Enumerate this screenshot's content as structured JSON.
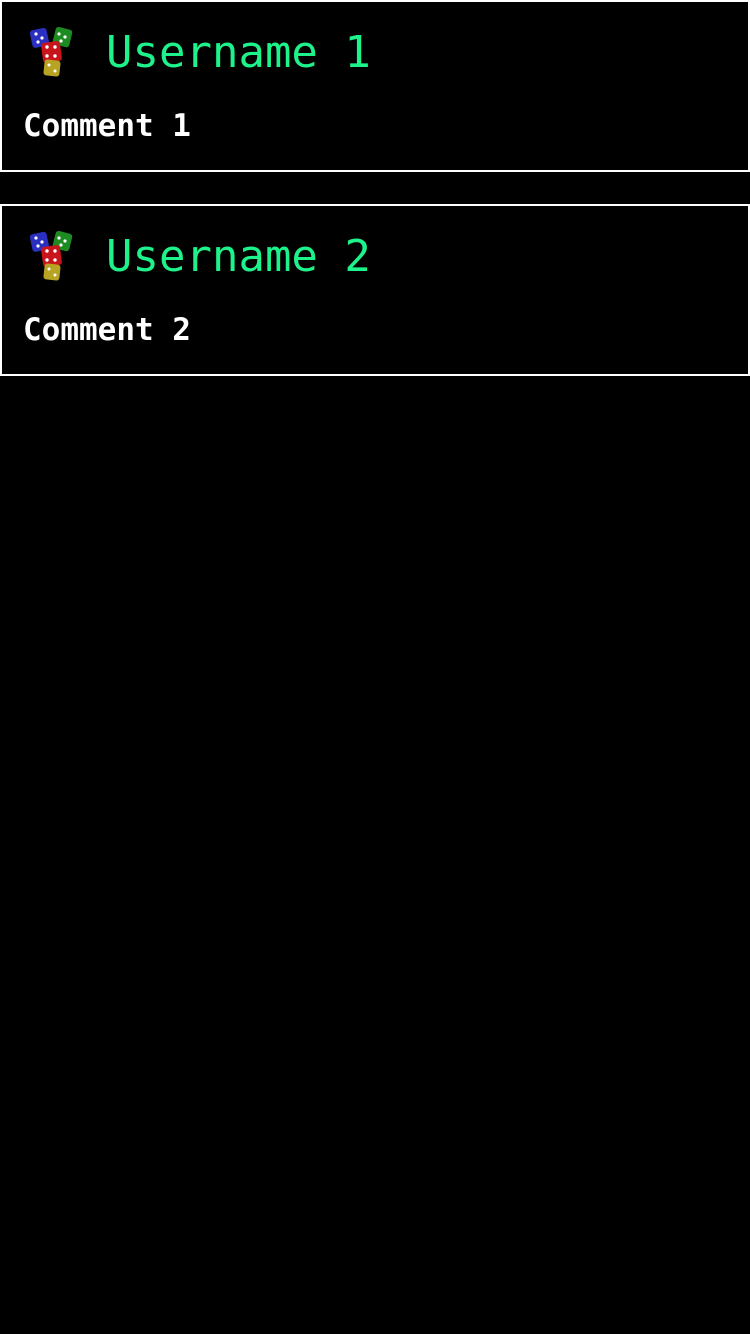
{
  "colors": {
    "background": "#000000",
    "card_border": "#ffffff",
    "username": "#1df28b",
    "comment": "#ffffff"
  },
  "comments": [
    {
      "avatar_icon": "dice-icon",
      "username": "Username 1",
      "text": "Comment 1"
    },
    {
      "avatar_icon": "dice-icon",
      "username": "Username 2",
      "text": "Comment 2"
    }
  ]
}
